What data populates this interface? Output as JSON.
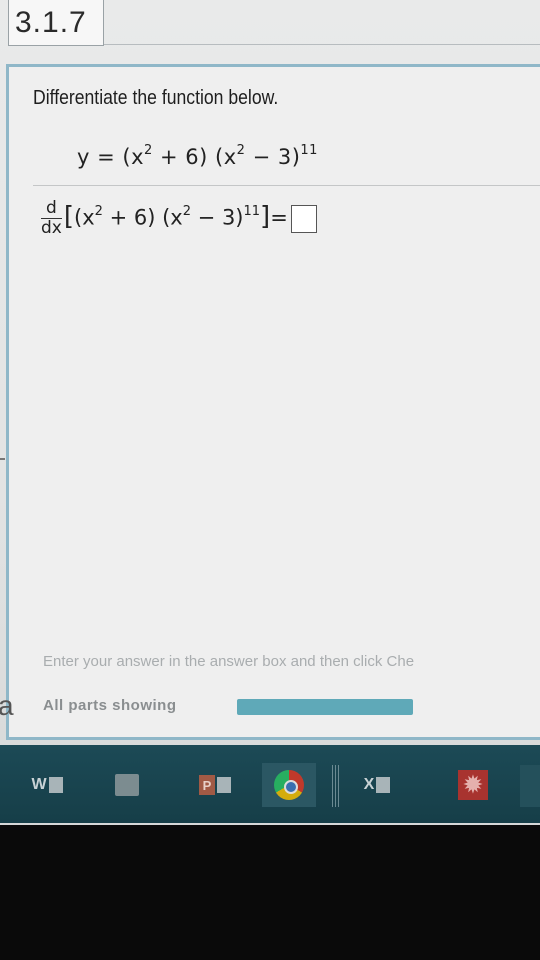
{
  "section": {
    "number": "3.1.7"
  },
  "question": {
    "prompt": "Differentiate the function below.",
    "function": {
      "lhs": "y",
      "equals": "=",
      "factor1": "(x",
      "factor1_exp": "2",
      "factor1_rest": " + 6)",
      "factor2": " (x",
      "factor2_exp": "2",
      "factor2_rest": " − 3)",
      "outer_exp": "11"
    },
    "derivative": {
      "numerator": "d",
      "denominator": "dx",
      "open_bracket": "[",
      "factor1": "(x",
      "factor1_exp": "2",
      "factor1_rest": " + 6)",
      "factor2": " (x",
      "factor2_exp": "2",
      "factor2_rest": " − 3)",
      "outer_exp": "11",
      "close_bracket": "]",
      "equals": "="
    }
  },
  "footer": {
    "instruction": "Enter your answer in the answer box and then click Che",
    "parts_label": "All parts showing",
    "progress_fraction": 1.0
  },
  "edge_letter": "a",
  "taskbar": {
    "word_label": "W",
    "powerpoint_label": "P",
    "excel_label": "X"
  },
  "colors": {
    "panel_border": "#8fb7c8",
    "taskbar": "#1c4a56",
    "progress": "#5fa9b8"
  }
}
